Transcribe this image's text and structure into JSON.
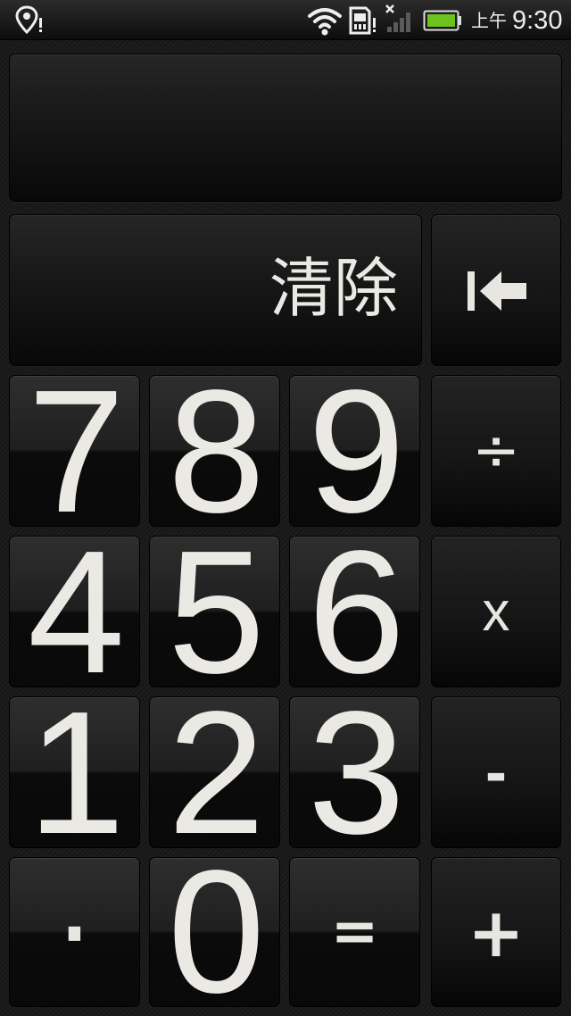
{
  "status_bar": {
    "ampm": "上午",
    "time": "9:30",
    "icons": [
      "location-alert-icon",
      "wifi-icon",
      "storage-alert-icon",
      "no-signal-icon",
      "battery-icon"
    ],
    "battery_color": "#6ec21e"
  },
  "display": {
    "value": ""
  },
  "keys": {
    "clear": "清除",
    "backspace_icon": "backspace-arrow-icon",
    "d7": "7",
    "d8": "8",
    "d9": "9",
    "d4": "4",
    "d5": "5",
    "d6": "6",
    "d1": "1",
    "d2": "2",
    "d3": "3",
    "d0": "0",
    "divide": "÷",
    "multiply": "x",
    "minus": "-",
    "plus": "+",
    "equals": "=",
    "decimal": "·"
  },
  "colors": {
    "key_text": "#ebe9e4",
    "background": "#1a1a1a"
  }
}
